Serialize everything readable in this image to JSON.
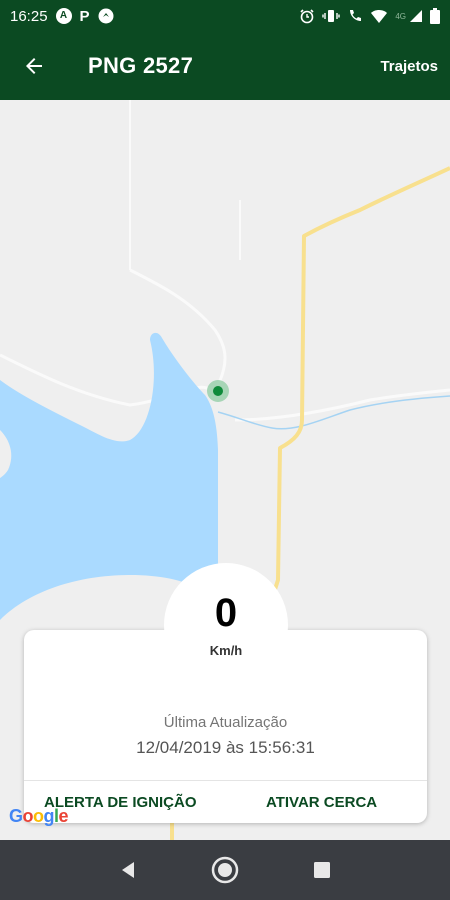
{
  "status_bar": {
    "time": "16:25",
    "network_label": "4G",
    "left_icons": [
      "assistant-icon",
      "parking-icon",
      "app-notification-icon"
    ],
    "right_icons": [
      "alarm-icon",
      "vibrate-icon",
      "wifi-calling-icon",
      "wifi-icon",
      "signal-icon",
      "battery-icon"
    ]
  },
  "app_bar": {
    "back_icon": "arrow-back-icon",
    "title": "PNG 2527",
    "action_label": "Trajetos"
  },
  "map": {
    "water_color": "#aadaff",
    "land_color": "#efefef",
    "road_color": "#f8e08e",
    "marker_color": "#0f8a3a",
    "logo_text": "Google"
  },
  "speed": {
    "value": "0",
    "unit": "Km/h"
  },
  "update": {
    "label": "Última Atualização",
    "value": "12/04/2019 às 15:56:31"
  },
  "actions": {
    "ignition_alert": "ALERTA DE IGNIÇÃO",
    "fence": "ATIVAR CERCA"
  },
  "colors": {
    "primary": "#0b4a22",
    "nav_bar": "#3a3d42"
  },
  "nav_bar": {
    "icons": [
      "back-triangle-icon",
      "home-circle-icon",
      "recents-square-icon"
    ]
  }
}
